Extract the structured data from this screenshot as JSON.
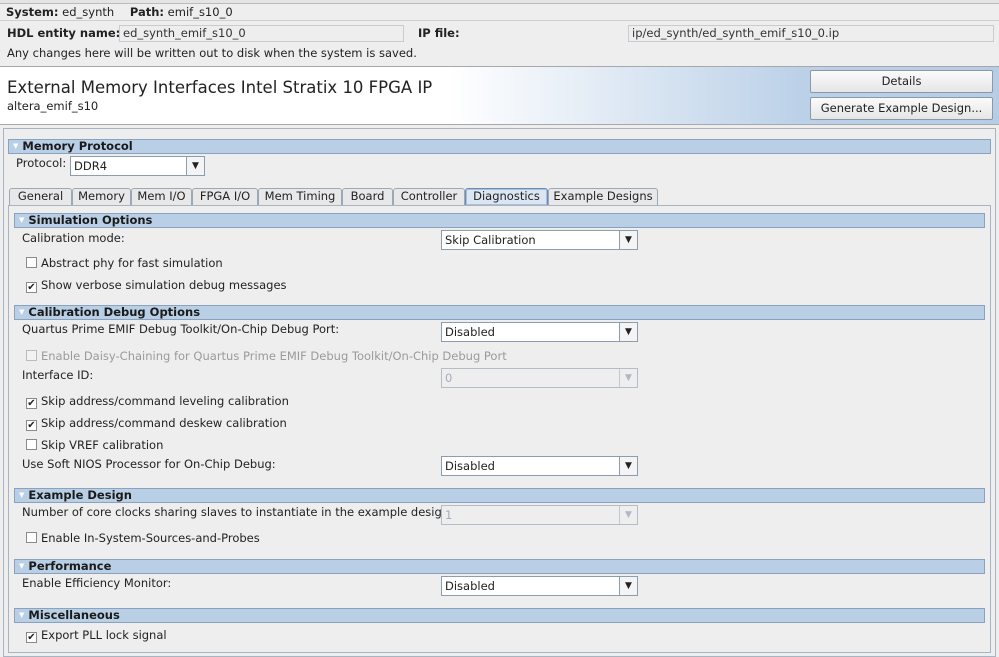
{
  "top": {
    "system_label": "System:",
    "system_value": "ed_synth",
    "path_label": "Path:",
    "path_value": "emif_s10_0"
  },
  "entity": {
    "hdl_label": "HDL entity name:",
    "hdl_value": "ed_synth_emif_s10_0",
    "ip_label": "IP file:",
    "ip_value": "ip/ed_synth/ed_synth_emif_s10_0.ip",
    "note": "Any changes here will be written out to disk when the system is saved."
  },
  "banner": {
    "title": "External Memory Interfaces Intel Stratix 10 FPGA IP",
    "subtitle": "altera_emif_s10",
    "details_button": "Details",
    "generate_button": "Generate Example Design..."
  },
  "memory_protocol": {
    "header": "Memory Protocol",
    "protocol_label": "Protocol:",
    "protocol_value": "DDR4"
  },
  "tabs": [
    "General",
    "Memory",
    "Mem I/O",
    "FPGA I/O",
    "Mem Timing",
    "Board",
    "Controller",
    "Diagnostics",
    "Example Designs"
  ],
  "active_tab": "Diagnostics",
  "simulation": {
    "header": "Simulation Options",
    "cal_mode_label": "Calibration mode:",
    "cal_mode_value": "Skip Calibration",
    "abstract_phy": {
      "label": "Abstract phy for fast simulation",
      "checked": false
    },
    "verbose": {
      "label": "Show verbose simulation debug messages",
      "checked": true
    }
  },
  "cal_debug": {
    "header": "Calibration Debug Options",
    "toolkit_label": "Quartus Prime EMIF Debug Toolkit/On-Chip Debug Port:",
    "toolkit_value": "Disabled",
    "daisy": {
      "label": "Enable Daisy-Chaining for Quartus Prime EMIF Debug Toolkit/On-Chip Debug Port",
      "checked": false
    },
    "interface_id_label": "Interface ID:",
    "interface_id_value": "0",
    "skip_leveling": {
      "label": "Skip address/command leveling calibration",
      "checked": true
    },
    "skip_deskew": {
      "label": "Skip address/command deskew calibration",
      "checked": true
    },
    "skip_vref": {
      "label": "Skip VREF calibration",
      "checked": false
    },
    "nios_label": "Use Soft NIOS Processor for On-Chip Debug:",
    "nios_value": "Disabled"
  },
  "example_design": {
    "header": "Example Design",
    "clocks_label": "Number of core clocks sharing slaves to instantiate in the example design:",
    "clocks_value": "1",
    "issp": {
      "label": "Enable In-System-Sources-and-Probes",
      "checked": false
    }
  },
  "performance": {
    "header": "Performance",
    "monitor_label": "Enable Efficiency Monitor:",
    "monitor_value": "Disabled"
  },
  "misc": {
    "header": "Miscellaneous",
    "pll_lock": {
      "label": "Export PLL lock signal",
      "checked": true
    }
  },
  "check_glyph": "✔",
  "arrow_glyph": "▼",
  "tri_glyph": "▼"
}
